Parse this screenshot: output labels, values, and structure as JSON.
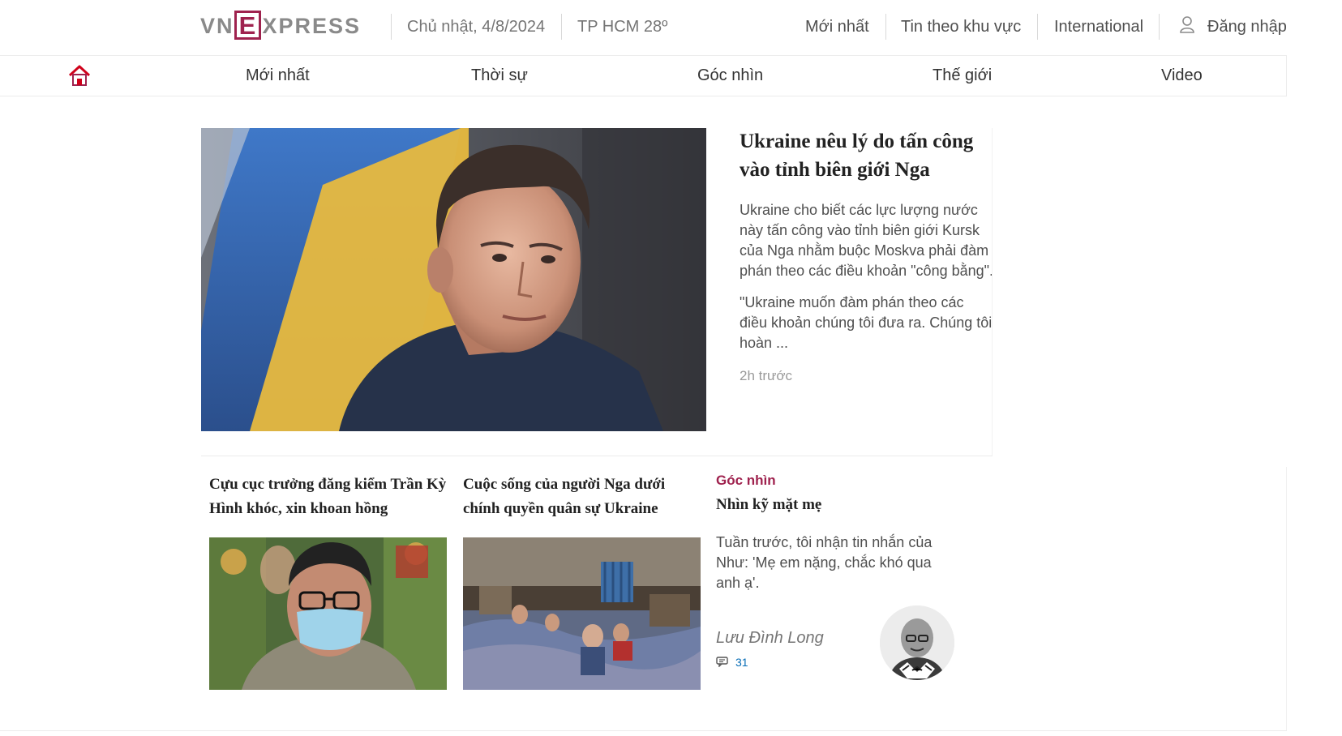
{
  "header": {
    "logo_left": "VN",
    "logo_e": "E",
    "logo_right": "XPRESS",
    "date": "Chủ nhật, 4/8/2024",
    "weather": "TP HCM 28º",
    "links": [
      "Mới nhất",
      "Tin theo khu vực",
      "International"
    ],
    "login": "Đăng nhập"
  },
  "nav": {
    "items": [
      "Mới nhất",
      "Thời sự",
      "Góc nhìn",
      "Thế giới",
      "Video"
    ]
  },
  "hero": {
    "title": "Ukraine nêu lý do tấn công vào tỉnh biên giới Nga",
    "description": "Ukraine cho biết các lực lượng nước này tấn công vào tỉnh biên giới Kursk của Nga nhằm buộc Moskva phải đàm phán theo các điều khoản \"công bằng\".",
    "quote": "\"Ukraine muốn đàm phán theo các điều khoản chúng tôi đưa ra. Chúng tôi hoàn ...",
    "time": "2h trước"
  },
  "stories": [
    {
      "title": "Cựu cục trưởng đăng kiểm Trần Kỳ Hình khóc, xin khoan hồng"
    },
    {
      "title": "Cuộc sống của người Nga dưới chính quyền quân sự Ukraine"
    }
  ],
  "opinion": {
    "category": "Góc nhìn",
    "title": "Nhìn kỹ mặt mẹ",
    "description": "Tuần trước, tôi nhận tin nhắn của Như: 'Mẹ em nặng, chắc khó qua anh ạ'.",
    "author": "Lưu Đình Long",
    "comments": "31"
  },
  "colors": {
    "brand": "#9f224e",
    "link_blue": "#076db6"
  }
}
